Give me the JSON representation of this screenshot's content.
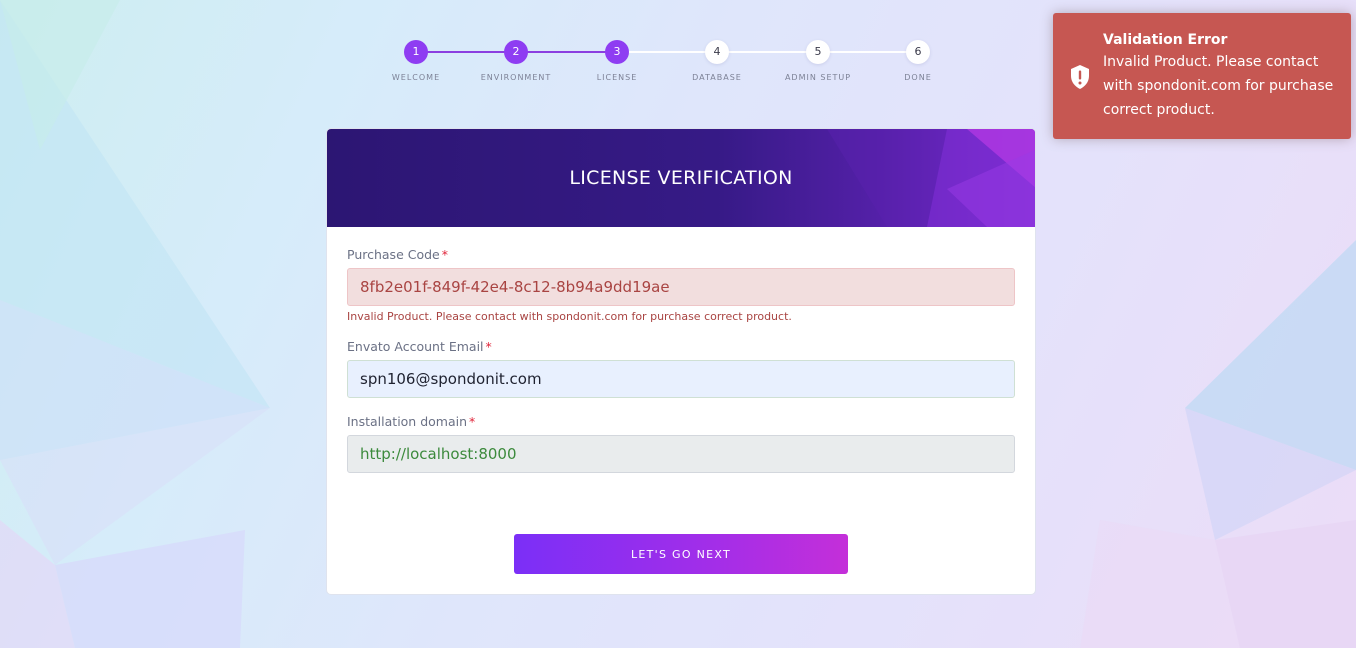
{
  "stepper": {
    "steps": [
      {
        "number": "1",
        "label": "WELCOME",
        "state": "done"
      },
      {
        "number": "2",
        "label": "ENVIRONMENT",
        "state": "done"
      },
      {
        "number": "3",
        "label": "LICENSE",
        "state": "current"
      },
      {
        "number": "4",
        "label": "DATABASE",
        "state": "pending"
      },
      {
        "number": "5",
        "label": "ADMIN SETUP",
        "state": "pending"
      },
      {
        "number": "6",
        "label": "DONE",
        "state": "pending"
      }
    ]
  },
  "card": {
    "title": "LICENSE VERIFICATION"
  },
  "form": {
    "purchase_code": {
      "label": "Purchase Code",
      "required_mark": "*",
      "value": "8fb2e01f-849f-42e4-8c12-8b94a9dd19ae",
      "error": "Invalid Product. Please contact with spondonit.com for purchase correct product."
    },
    "envato_email": {
      "label": "Envato Account Email",
      "required_mark": "*",
      "value": "spn106@spondonit.com"
    },
    "installation_domain": {
      "label": "Installation domain",
      "required_mark": "*",
      "value": "http://localhost:8000"
    },
    "submit_label": "LET'S GO NEXT"
  },
  "toast": {
    "title": "Validation Error",
    "message": "Invalid Product. Please contact with spondonit.com for purchase correct product.",
    "icon": "shield-alert-icon"
  },
  "colors": {
    "accent": "#8e3df2",
    "header_dark": "#2c1673",
    "error_toast": "#c65752",
    "error_text": "#a94442"
  }
}
